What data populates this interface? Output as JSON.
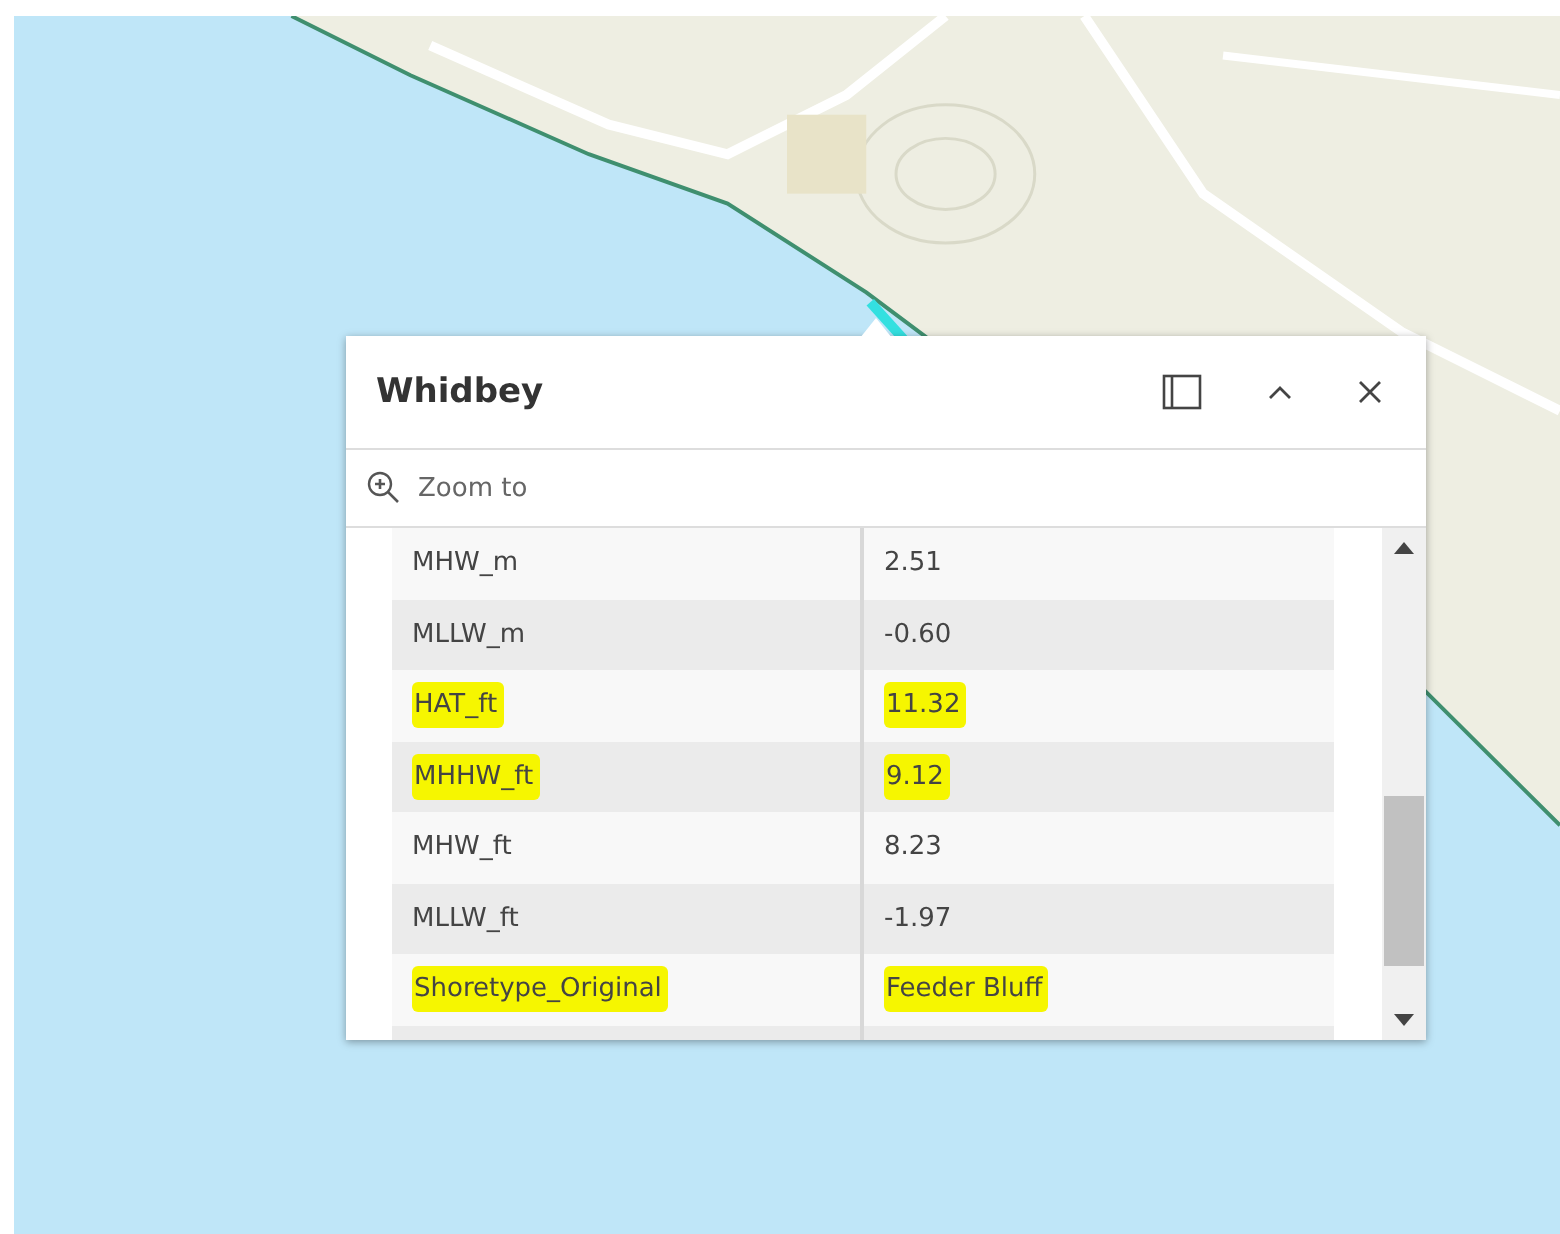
{
  "popup": {
    "title": "Whidbey",
    "zoom_action": "Zoom to",
    "rows": [
      {
        "field": "MHW_m",
        "value": "2.51",
        "highlighted": false
      },
      {
        "field": "MLLW_m",
        "value": "-0.60",
        "highlighted": false
      },
      {
        "field": "HAT_ft",
        "value": "11.32",
        "highlighted": true
      },
      {
        "field": "MHHW_ft",
        "value": "9.12",
        "highlighted": true
      },
      {
        "field": "MHW_ft",
        "value": "8.23",
        "highlighted": false
      },
      {
        "field": "MLLW_ft",
        "value": "-1.97",
        "highlighted": false
      },
      {
        "field": "Shoretype_Original",
        "value": "Feeder Bluff",
        "highlighted": true
      }
    ]
  }
}
